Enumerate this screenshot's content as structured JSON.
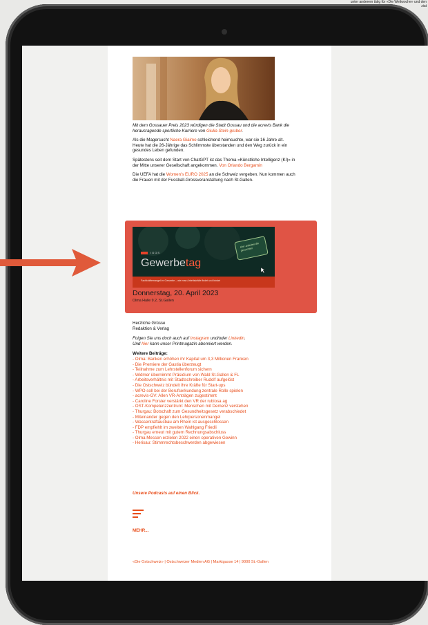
{
  "background": {
    "text_lines": [
      "unter anderem tätig für «Die Weltwoche» und den",
      "ziat"
    ]
  },
  "email": {
    "intro": {
      "text": "Mit dem Gossauer Preis 2023 würdigen die Stadt Gossau und die acrevis Bank die herausragende sportliche Karriere von ",
      "link": "Giulia Stein-gruber",
      "end": "."
    },
    "p2": {
      "a": "Als die Magersucht ",
      "link": "Naera Giaimo",
      "b": " schleichend heimsuchte, war sie 16 Jahre alt. Heute hat die 26-Jährige das Schlimmste überstanden und den Weg zurück in ein gesundes Leben gefunden."
    },
    "p3": {
      "a": "Spätestens seit dem Start von ChatGPT ist das Thema «Künstliche Intelligenz (KI)» in der Mitte unserer Gesellschaft angekommen. ",
      "link": "Von Orlando Bergamin"
    },
    "p4": {
      "a": "Die UEFA hat die ",
      "link": "Women's EURO 2025",
      "b": " an die Schweiz vergeben. Nun kommen auch die Frauen mit der Fussball-Grossveranstaltung nach St.Gallen."
    },
    "banner": {
      "brand_small": "IGGS",
      "title_main": "Gewerbe",
      "title_accent": "tag",
      "subtitle": "Fachkräftemangel im Gewerbe – wie man Arbeitskräfte findet und bindet",
      "sign_text": "Hier arbeiten die gesuchten",
      "date": "Donnerstag, 20. April 2023",
      "place": "Olma Halle 9.2, St.Gallen"
    },
    "greeting": [
      "Herzliche Grüsse",
      "Redaktion & Verlag"
    ],
    "follow": {
      "a": "Folgen Sie uns doch auch auf ",
      "instagram": "Instagram",
      "b": " und/oder ",
      "linkedin": "Linkedin",
      "c": ".",
      "d": "Und ",
      "hier": "hier",
      "e": " kann unser Printmagazin abonniert werden."
    },
    "more_title": "Weitere Beiträge:",
    "more_links": [
      "- Olma: Banken erhöhen ihr Kapital um 3,3 Millionen Franken",
      "- Die Premiere der Gastia überzeugt",
      "- Teilnahme zum Lehrstellenforum sichern",
      "- Widmer übernimmt Präsidium von Wald St.Gallen & FL",
      "- Arbeitsverhältnis mit Stadtschreiber Rudolf aufgelöst",
      "- Die Ostschweiz bündelt ihre Kräfte für Start-ups",
      "- WPO soll bei der Berufserkundung zentrale Rolle spielen",
      "- acrevis-GV: Allen VR-Anträgen zugestimmt",
      "- Caroline Forster verstärkt den VR der rubiosa ag",
      "- OST-Kompetenzzentrum: Menschen mit Demenz verstehen",
      "- Thurgau: Botschaft zum Gesundheitsgesetz verabschiedet",
      "- Miteinander gegen den Lehrpersonenmangel",
      "- Wasserkraftausbau am Rhein ist ausgeschlossen",
      "- FDP empfiehlt im zweiten Wahlgang Friedli",
      "- Thurgau erneut mit gutem Rechnungsabschluss",
      "- Olma Messen erzielen 2022 einen operativen Gewinn",
      "- Herisau: Stimmrechtsbeschwerden abgewiesen"
    ],
    "podcasts": "Unsere Podcasts auf einen Blick.",
    "menu_icon": "menu-lines-icon",
    "mehr": "MEHR...",
    "footer": "«Die Ostschweiz» | Ostschweizer Medien AG | Marktgasse 14 | 9000 St.-Gallen"
  },
  "colors": {
    "accent": "#e84e1b",
    "highlight": "#e05445",
    "arrow": "#e05a3a",
    "bezel": "#121212"
  }
}
